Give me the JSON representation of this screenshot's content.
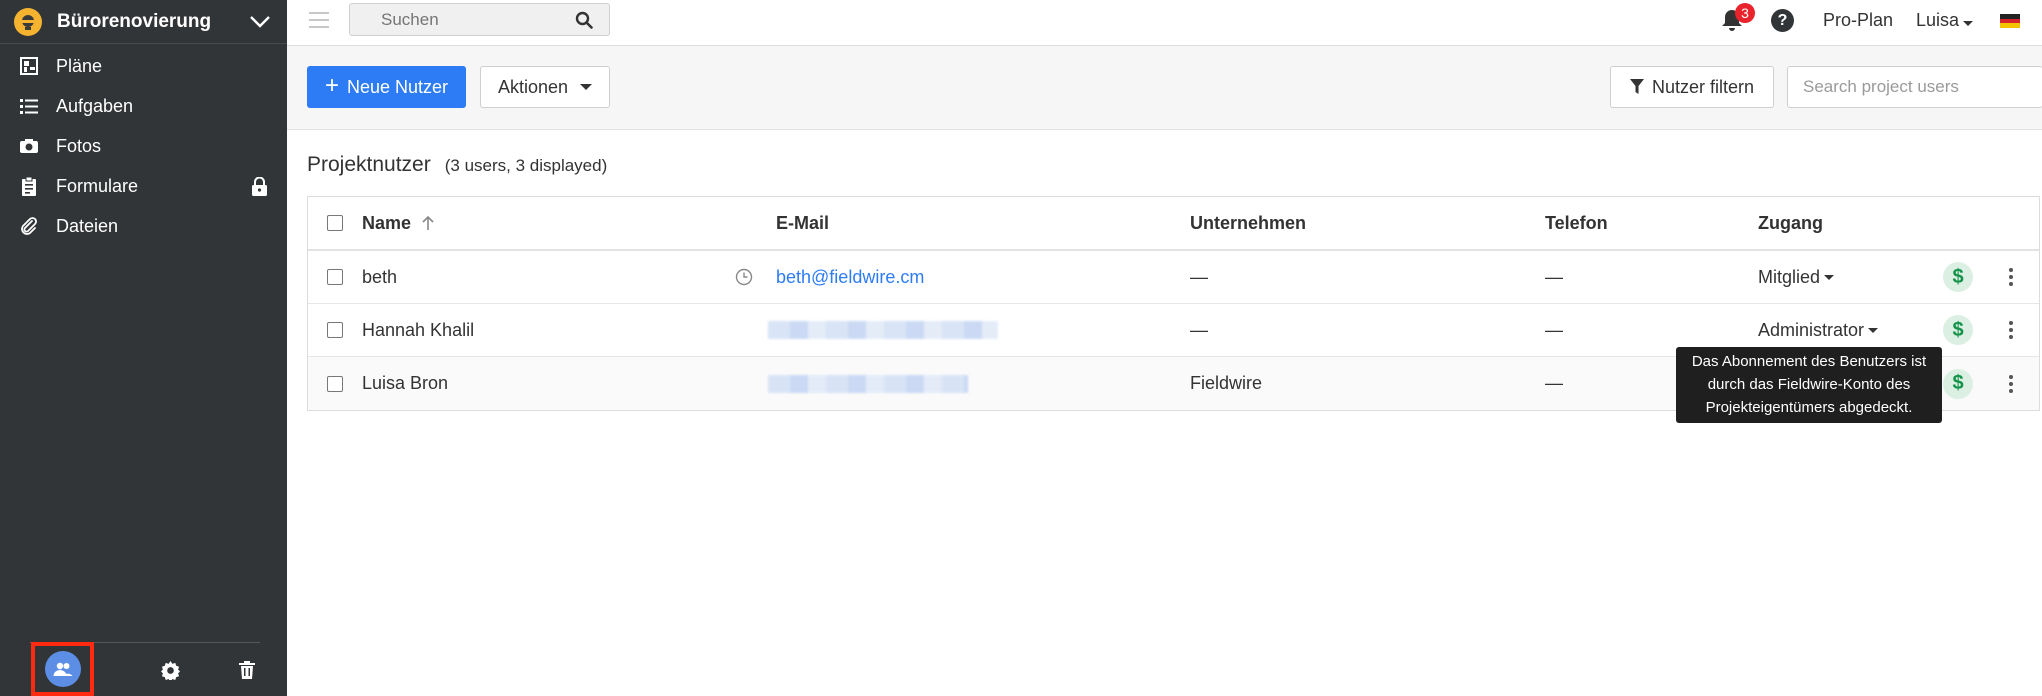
{
  "project": {
    "name": "Bürorenovierung"
  },
  "sidebar": {
    "items": [
      {
        "label": "Pläne",
        "icon": "plans-icon"
      },
      {
        "label": "Aufgaben",
        "icon": "tasks-icon"
      },
      {
        "label": "Fotos",
        "icon": "camera-icon"
      },
      {
        "label": "Formulare",
        "icon": "forms-icon",
        "locked": true
      },
      {
        "label": "Dateien",
        "icon": "paperclip-icon"
      }
    ],
    "bottom": [
      "users-icon",
      "gear-icon",
      "trash-icon"
    ]
  },
  "topbar": {
    "search_placeholder": "Suchen",
    "notification_count": "3",
    "help_label": "?",
    "plan_label": "Pro-Plan",
    "user_name": "Luisa"
  },
  "toolbar": {
    "new_user_label": "Neue Nutzer",
    "actions_label": "Aktionen",
    "filter_label": "Nutzer filtern",
    "search_placeholder": "Search project users"
  },
  "content": {
    "title": "Projektnutzer",
    "count_text": "(3 users, 3 displayed)"
  },
  "table": {
    "headers": {
      "name": "Name",
      "email": "E-Mail",
      "company": "Unternehmen",
      "phone": "Telefon",
      "access": "Zugang"
    },
    "rows": [
      {
        "name": "beth",
        "email": "beth@fieldwire.cm",
        "company": "—",
        "phone": "—",
        "access": "Mitglied"
      },
      {
        "name": "Hannah Khalil",
        "email": "",
        "company": "—",
        "phone": "—",
        "access": "Administrator"
      },
      {
        "name": "Luisa Bron",
        "email": "",
        "company": "Fieldwire",
        "phone": "—",
        "access": ""
      }
    ]
  },
  "tooltip": {
    "text": "Das Abonnement des Benutzers ist durch das Fieldwire-Konto des Projekteigentümers abgedeckt."
  },
  "colors": {
    "sidebar_bg": "#323537",
    "primary": "#2d7cf6",
    "highlight_border": "#ff2a10",
    "dollar_green": "#16934b",
    "badge_red": "#e8232b"
  }
}
